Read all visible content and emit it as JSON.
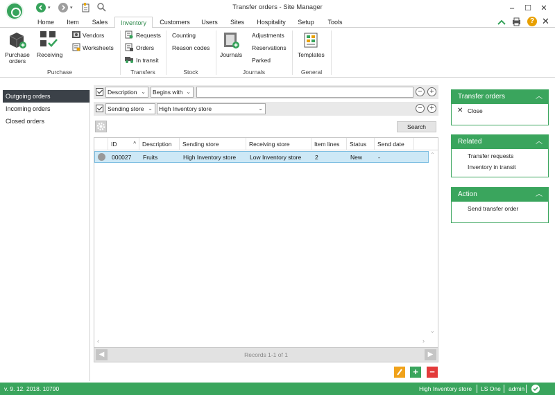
{
  "window": {
    "title": "Transfer orders - Site Manager"
  },
  "tabs": [
    "Home",
    "Item",
    "Sales",
    "Inventory",
    "Customers",
    "Users",
    "Sites",
    "Hospitality",
    "Setup",
    "Tools"
  ],
  "active_tab": "Inventory",
  "ribbon": {
    "purchase_orders": "Purchase",
    "purchase_orders2": "orders",
    "receiving": "Receiving",
    "vendors": "Vendors",
    "worksheets": "Worksheets",
    "group_purchase": "Purchase",
    "requests": "Requests",
    "orders": "Orders",
    "in_transit": "In transit",
    "group_transfers": "Transfers",
    "counting": "Counting",
    "reason_codes": "Reason codes",
    "group_stock": "Stock",
    "journals": "Journals",
    "adjustments": "Adjustments",
    "reservations": "Reservations",
    "parked": "Parked",
    "group_journals": "Journals",
    "templates": "Templates",
    "group_general": "General"
  },
  "leftnav": [
    "Outgoing orders",
    "Incoming orders",
    "Closed orders"
  ],
  "filter": {
    "row1_field": "Description",
    "row1_op": "Begins with",
    "row1_value": "",
    "row2_field": "Sending store",
    "row2_value": "High Inventory store",
    "search_label": "Search"
  },
  "grid": {
    "headers": [
      "ID",
      "Description",
      "Sending store",
      "Receiving store",
      "Item lines",
      "Status",
      "Send date"
    ],
    "rows": [
      [
        "000027",
        "Fruits",
        "High Inventory store",
        "Low Inventory store",
        "2",
        "New",
        "-"
      ]
    ],
    "records": "Records 1-1 of 1"
  },
  "panels": {
    "transfer_orders": {
      "title": "Transfer orders",
      "items": [
        "Close"
      ]
    },
    "related": {
      "title": "Related",
      "items": [
        "Transfer requests",
        "Inventory in transit"
      ]
    },
    "action": {
      "title": "Action",
      "items": [
        "Send transfer order"
      ]
    }
  },
  "status": {
    "version": "v. 9. 12. 2018. 10790",
    "store": "High Inventory store",
    "app": "LS One",
    "user": "admin"
  },
  "colors": {
    "accent": "#3aa55d",
    "nav_selected": "#3b4148",
    "row_selected": "#cde8f6"
  }
}
